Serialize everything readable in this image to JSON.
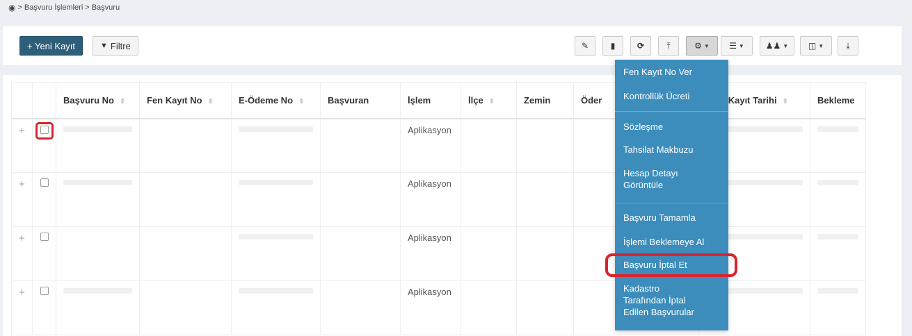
{
  "breadcrumb": {
    "home_icon": "dashboard-icon",
    "items": [
      "Başvuru İşlemleri",
      "Başvuru"
    ],
    "separator": ">"
  },
  "toolbar": {
    "new_label": "+ Yeni Kayıt",
    "filter_label": "Filtre",
    "icons": [
      "pencil-icon",
      "trash-icon",
      "refresh-icon",
      "upload-icon",
      "cogs-icon",
      "list-icon",
      "users-icon",
      "columns-icon",
      "download-icon"
    ]
  },
  "table": {
    "columns": [
      "Başvuru No",
      "Fen Kayıt No",
      "E-Ödeme No",
      "Başvuran",
      "İşlem",
      "İlçe",
      "Zemin",
      "Öder",
      "",
      "Fen Kayıt Tarihi",
      "Bekleme"
    ],
    "rows": [
      {
        "islem": "Aplikasyon"
      },
      {
        "islem": "Aplikasyon"
      },
      {
        "islem": "Aplikasyon"
      },
      {
        "islem": "Aplikasyon"
      }
    ]
  },
  "dropdown": {
    "items": [
      "Fen Kayıt No Ver",
      "Kontrollük Ücreti",
      "Sözleşme",
      "Tahsilat Makbuzu",
      "Hesap Detayı Görüntüle",
      "Başvuru Tamamla",
      "İşlemi Beklemeye Al",
      "Başvuru İptal Et",
      "Kadastro Tarafından İptal Edilen Başvurular"
    ]
  },
  "colors": {
    "primary_button": "#2e5e7a",
    "dropdown_bg": "#3c8dbc",
    "highlight": "#d9232e"
  }
}
